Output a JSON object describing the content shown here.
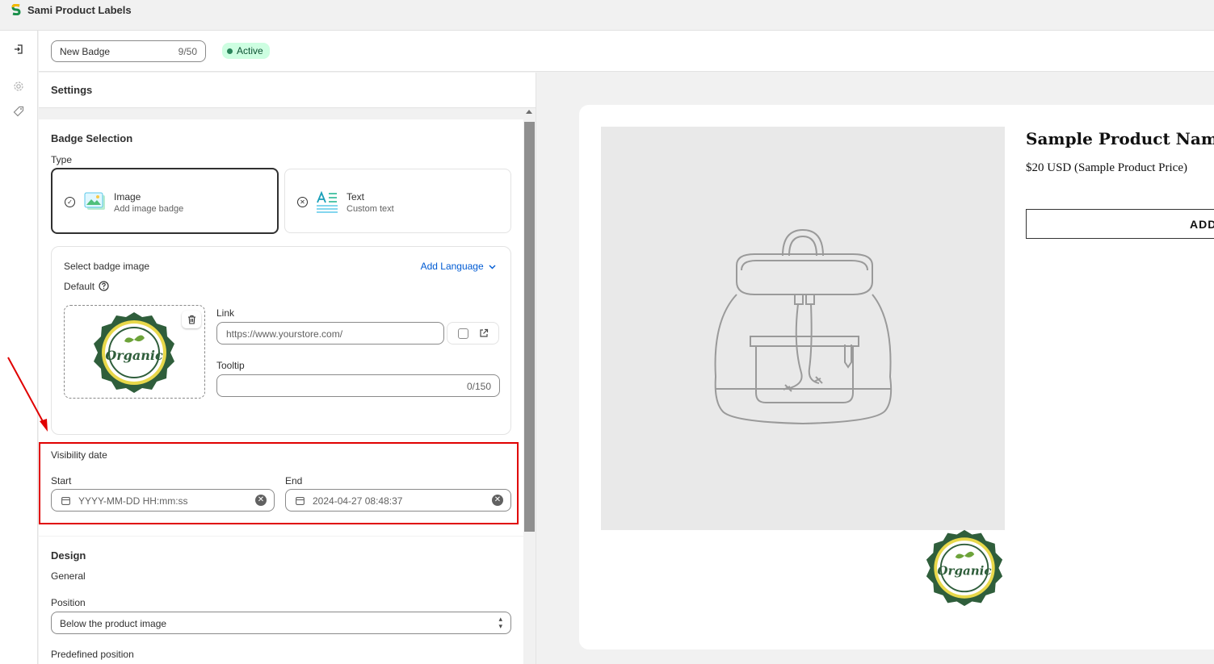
{
  "app": {
    "title": "Sami Product Labels",
    "logo_icon": "sami-logo-icon"
  },
  "rail": {
    "items": [
      "exit-icon",
      "gear-icon",
      "tag-icon"
    ]
  },
  "header": {
    "badge_name": "New Badge",
    "badge_name_count": "9/50",
    "status": "Active",
    "status_color": "#cdfee1"
  },
  "settings": {
    "title": "Settings",
    "badge_selection": {
      "title": "Badge Selection",
      "type_label": "Type",
      "options": [
        {
          "title": "Image",
          "subtitle": "Add image badge",
          "selected": true,
          "icon": "image-icon"
        },
        {
          "title": "Text",
          "subtitle": "Custom text",
          "selected": false,
          "icon": "text-format-icon"
        }
      ],
      "select_image_label": "Select badge image",
      "add_language": "Add Language",
      "default_label": "Default",
      "badge_image_text": "Organic",
      "link_label": "Link",
      "link_value": "https://www.yourstore.com/",
      "tooltip_label": "Tooltip",
      "tooltip_count": "0/150"
    },
    "visibility": {
      "title": "Visibility date",
      "start_label": "Start",
      "start_placeholder": "YYYY-MM-DD HH:mm:ss",
      "end_label": "End",
      "end_value": "2024-04-27 08:48:37",
      "highlight_color": "#e00000"
    },
    "design": {
      "title": "Design",
      "general_label": "General",
      "position_label": "Position",
      "position_value": "Below the product image",
      "predefined_label": "Predefined position"
    }
  },
  "preview": {
    "product_name": "Sample Product Name",
    "product_price": "$20 USD (Sample Product Price)",
    "add_button": "ADD",
    "badge_text": "Organic"
  }
}
